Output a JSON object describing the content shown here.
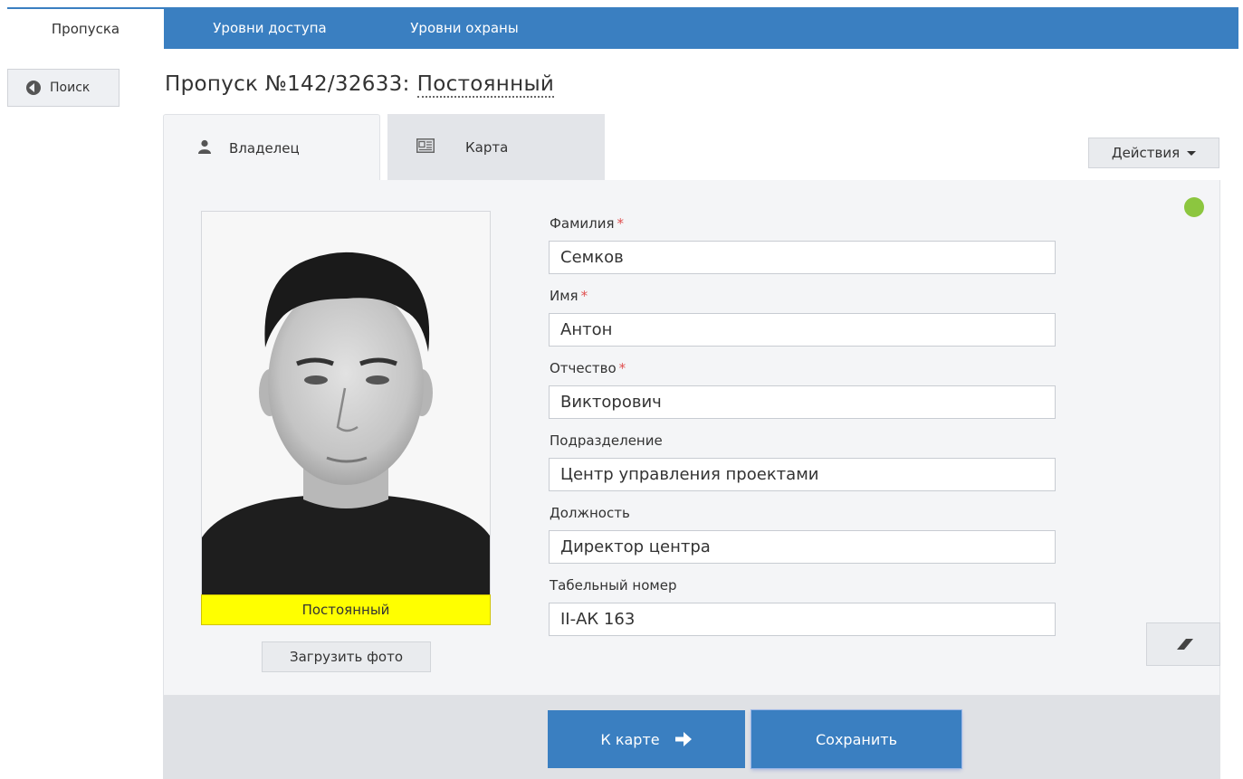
{
  "nav": {
    "tabs": [
      {
        "label": "Пропуска",
        "active": true
      },
      {
        "label": "Уровни доступа",
        "active": false
      },
      {
        "label": "Уровни охраны",
        "active": false
      }
    ]
  },
  "back_button": {
    "label": "Поиск",
    "icon": "arrow-left-circle-icon"
  },
  "page": {
    "title": "Пропуск №142/32633:",
    "pass_type": "Постоянный"
  },
  "form_tabs": [
    {
      "label": "Владелец",
      "icon": "user-icon",
      "active": true
    },
    {
      "label": "Карта",
      "icon": "id-card-icon",
      "active": false
    }
  ],
  "actions_button": {
    "label": "Действия"
  },
  "status": {
    "color": "#8cc63f"
  },
  "photo": {
    "caption": "Постоянный",
    "caption_color": "#ffff00",
    "upload_label": "Загрузить фото"
  },
  "fields": [
    {
      "label": "Фамилия",
      "required": "*",
      "value": "Семков"
    },
    {
      "label": "Имя",
      "required": "*",
      "value": "Антон"
    },
    {
      "label": "Отчество",
      "required": "*",
      "value": "Викторович"
    },
    {
      "label": "Подразделение",
      "required": "",
      "value": "Центр управления проектами"
    },
    {
      "label": "Должность",
      "required": "",
      "value": "Директор центра"
    },
    {
      "label": "Табельный номер",
      "required": "",
      "value": "II-АК 163"
    }
  ],
  "footer": {
    "next_label": "К карте",
    "save_label": "Сохранить"
  },
  "colors": {
    "accent": "#3a7fc1"
  }
}
